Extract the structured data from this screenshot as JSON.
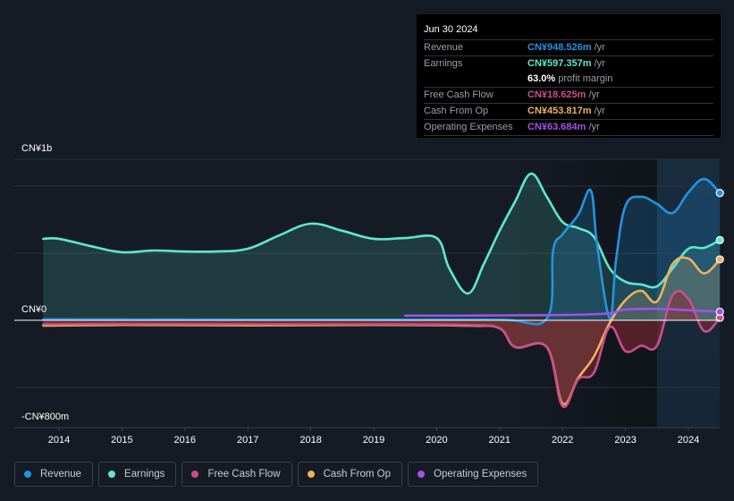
{
  "chart_data": {
    "type": "area",
    "title": "",
    "xlabel": "",
    "ylabel": "",
    "unit": "CN¥ millions",
    "ylim": [
      -800,
      1200
    ],
    "xlim": [
      2013.75,
      2024.5
    ],
    "y_tick_labels": [
      {
        "value": 1200,
        "label": "CN¥1b"
      },
      {
        "value": 0,
        "label": "CN¥0"
      },
      {
        "value": -800,
        "label": "-CN¥800m"
      }
    ],
    "gridlines": [
      1200,
      1000,
      500,
      0,
      -500,
      -800
    ],
    "x_ticks": [
      2014,
      2015,
      2016,
      2017,
      2018,
      2019,
      2020,
      2021,
      2022,
      2023,
      2024
    ],
    "x_tick_labels": [
      "2014",
      "2015",
      "2016",
      "2017",
      "2018",
      "2019",
      "2020",
      "2021",
      "2022",
      "2023",
      "2024"
    ],
    "highlight_from": 2023.5,
    "grid": true,
    "legend_position": "bottom-left",
    "series": [
      {
        "name": "Revenue",
        "color": "#2394df",
        "fill": true,
        "x": [
          2013.75,
          2015,
          2017,
          2019,
          2021,
          2021.75,
          2021.85,
          2022.0,
          2022.25,
          2022.45,
          2022.55,
          2022.75,
          2022.85,
          2023.0,
          2023.25,
          2023.5,
          2023.75,
          2024.0,
          2024.25,
          2024.5
        ],
        "y": [
          7,
          6,
          5,
          5,
          5,
          13,
          520,
          640,
          787,
          967,
          560,
          13,
          450,
          853,
          920,
          867,
          800,
          953,
          1053,
          948.526
        ]
      },
      {
        "name": "Earnings",
        "color": "#5ee8cd",
        "fill": true,
        "x": [
          2013.75,
          2014.0,
          2014.5,
          2015.0,
          2015.5,
          2016.0,
          2016.5,
          2017.0,
          2017.5,
          2018.0,
          2018.5,
          2019.0,
          2019.5,
          2020.0,
          2020.2,
          2020.5,
          2020.75,
          2021.0,
          2021.25,
          2021.5,
          2021.75,
          2022.0,
          2022.25,
          2022.5,
          2022.75,
          2023.0,
          2023.25,
          2023.5,
          2023.75,
          2024.0,
          2024.25,
          2024.5
        ],
        "y": [
          607,
          607,
          553,
          507,
          520,
          513,
          513,
          533,
          633,
          720,
          667,
          607,
          613,
          613,
          387,
          200,
          420,
          667,
          887,
          1093,
          920,
          733,
          687,
          620,
          387,
          287,
          267,
          253,
          387,
          533,
          540,
          597.357
        ]
      },
      {
        "name": "Free Cash Flow",
        "color": "#cb4e8c",
        "fill": true,
        "x": [
          2013.75,
          2015,
          2017,
          2019,
          2020.5,
          2021.0,
          2021.25,
          2021.75,
          2022.0,
          2022.25,
          2022.5,
          2022.75,
          2023.0,
          2023.25,
          2023.5,
          2023.75,
          2024.0,
          2024.25,
          2024.5
        ],
        "y": [
          -30,
          -28,
          -30,
          -30,
          -35,
          -60,
          -200,
          -200,
          -640,
          -440,
          -390,
          -50,
          -230,
          -190,
          -190,
          187,
          160,
          -80,
          18.625
        ]
      },
      {
        "name": "Cash From Op",
        "color": "#f0b15a",
        "fill": true,
        "x": [
          2013.75,
          2015,
          2017,
          2019,
          2020.5,
          2021.0,
          2021.25,
          2021.75,
          2022.0,
          2022.25,
          2022.5,
          2022.75,
          2023.0,
          2023.25,
          2023.5,
          2023.75,
          2024.0,
          2024.25,
          2024.5
        ],
        "y": [
          -40,
          -35,
          -38,
          -35,
          -40,
          -60,
          -200,
          -200,
          -620,
          -430,
          -270,
          -20,
          150,
          220,
          140,
          420,
          460,
          350,
          453.817
        ]
      },
      {
        "name": "Operating Expenses",
        "color": "#a351e8",
        "fill": false,
        "x": [
          2019.5,
          2020.5,
          2021.5,
          2022.0,
          2022.5,
          2022.8,
          2023.0,
          2023.5,
          2024.0,
          2024.5
        ],
        "y": [
          35,
          35,
          38,
          40,
          45,
          55,
          80,
          85,
          75,
          63.684
        ]
      }
    ]
  },
  "tooltip": {
    "date": "Jun 30 2024",
    "rows": [
      {
        "label": "Revenue",
        "value": "CN¥948.526m",
        "suffix": " /yr",
        "color": "#2394df"
      },
      {
        "label": "Earnings",
        "value": "CN¥597.357m",
        "suffix": " /yr",
        "color": "#5ee8cd"
      },
      {
        "label": "",
        "value": "63.0%",
        "suffix": " profit margin",
        "color": "#ffffff"
      },
      {
        "label": "Free Cash Flow",
        "value": "CN¥18.625m",
        "suffix": " /yr",
        "color": "#cb4e8c"
      },
      {
        "label": "Cash From Op",
        "value": "CN¥453.817m",
        "suffix": " /yr",
        "color": "#f0b15a"
      },
      {
        "label": "Operating Expenses",
        "value": "CN¥63.684m",
        "suffix": " /yr",
        "color": "#a351e8"
      }
    ]
  },
  "legend": [
    {
      "label": "Revenue",
      "color": "#2394df"
    },
    {
      "label": "Earnings",
      "color": "#5ee8cd"
    },
    {
      "label": "Free Cash Flow",
      "color": "#cb4e8c"
    },
    {
      "label": "Cash From Op",
      "color": "#f0b15a"
    },
    {
      "label": "Operating Expenses",
      "color": "#a351e8"
    }
  ]
}
